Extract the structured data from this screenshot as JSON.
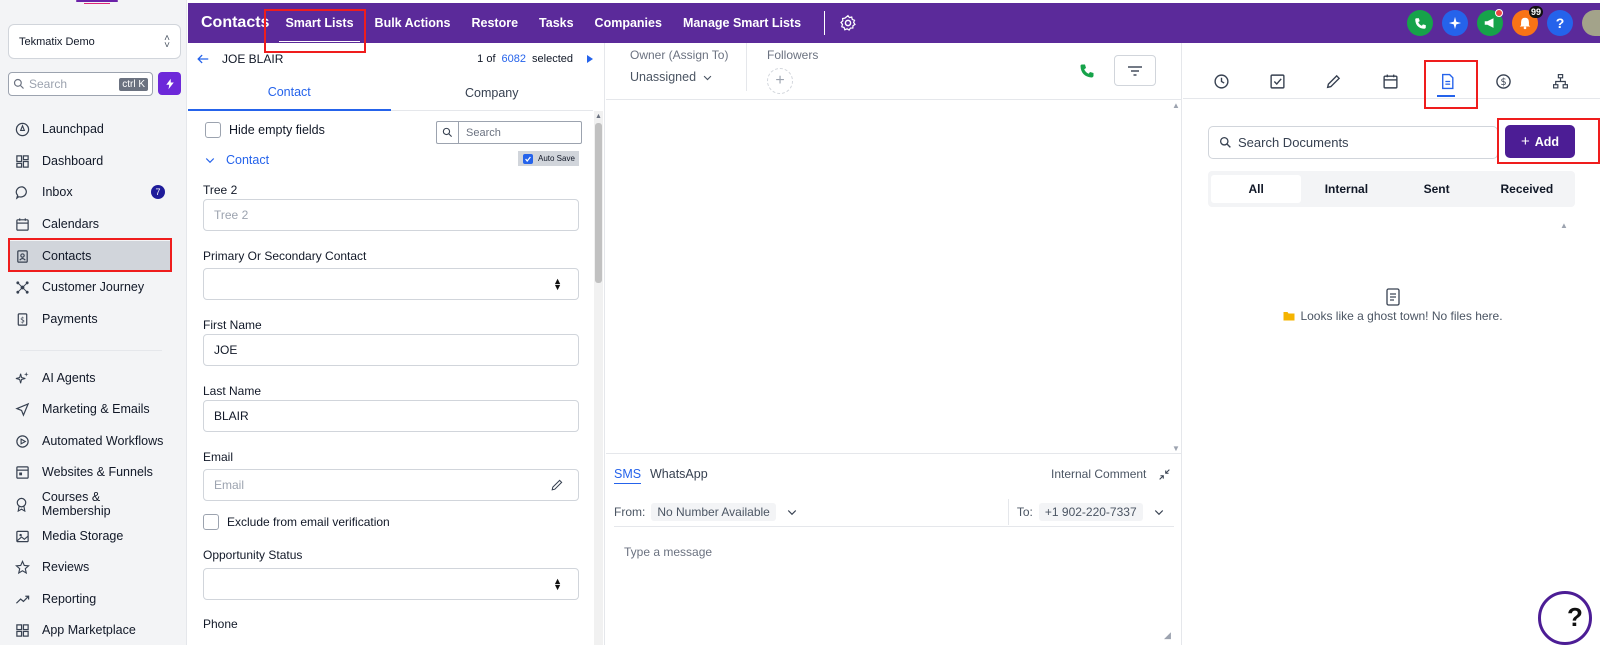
{
  "sidebar": {
    "account": "Tekmatix Demo",
    "search_placeholder": "Search",
    "search_shortcut": "ctrl K",
    "nav_items": [
      {
        "label": "Launchpad"
      },
      {
        "label": "Dashboard"
      },
      {
        "label": "Inbox",
        "badge": "7"
      },
      {
        "label": "Calendars"
      },
      {
        "label": "Contacts",
        "active": true
      },
      {
        "label": "Customer Journey"
      },
      {
        "label": "Payments"
      },
      {
        "label": "AI Agents"
      },
      {
        "label": "Marketing & Emails"
      },
      {
        "label": "Automated Workflows"
      },
      {
        "label": "Websites & Funnels"
      },
      {
        "label": "Courses & Membership"
      },
      {
        "label": "Media Storage"
      },
      {
        "label": "Reviews"
      },
      {
        "label": "Reporting"
      },
      {
        "label": "App Marketplace"
      }
    ]
  },
  "topbar": {
    "title": "Contacts",
    "tabs": [
      "Smart Lists",
      "Bulk Actions",
      "Restore",
      "Tasks",
      "Companies",
      "Manage Smart Lists"
    ],
    "notification_count": "99",
    "help_label": "?"
  },
  "contact": {
    "name": "JOE BLAIR",
    "pager_prefix": "1 of",
    "pager_count": "6082",
    "pager_suffix": "selected",
    "tabs": [
      "Contact",
      "Company"
    ],
    "hide_empty_label": "Hide empty fields",
    "search_placeholder": "Search",
    "section_label": "Contact",
    "auto_save_label": "Auto Save",
    "fields": {
      "tree2_label": "Tree 2",
      "tree2_placeholder": "Tree 2",
      "primary_label": "Primary Or Secondary Contact",
      "first_name_label": "First Name",
      "first_name_value": "JOE",
      "last_name_label": "Last Name",
      "last_name_value": "BLAIR",
      "email_label": "Email",
      "email_placeholder": "Email",
      "exclude_email_label": "Exclude from email verification",
      "opportunity_label": "Opportunity Status",
      "phone_label": "Phone"
    }
  },
  "center": {
    "owner_label": "Owner (Assign To)",
    "owner_value": "Unassigned",
    "followers_label": "Followers",
    "message": {
      "tabs": [
        "SMS",
        "WhatsApp"
      ],
      "internal_comment": "Internal Comment",
      "from_label": "From:",
      "from_value": "No Number Available",
      "to_label": "To:",
      "to_value": "+1 902-220-7337",
      "placeholder": "Type a message"
    }
  },
  "documents": {
    "search_placeholder": "Search Documents",
    "add_label": "Add",
    "filters": [
      "All",
      "Internal",
      "Sent",
      "Received"
    ],
    "empty_message": "Looks like a ghost town! No files here."
  },
  "colors": {
    "brand_purple": "#5b2a9a",
    "accent_blue": "#2563eb",
    "highlight_red": "#ef1d1d"
  }
}
